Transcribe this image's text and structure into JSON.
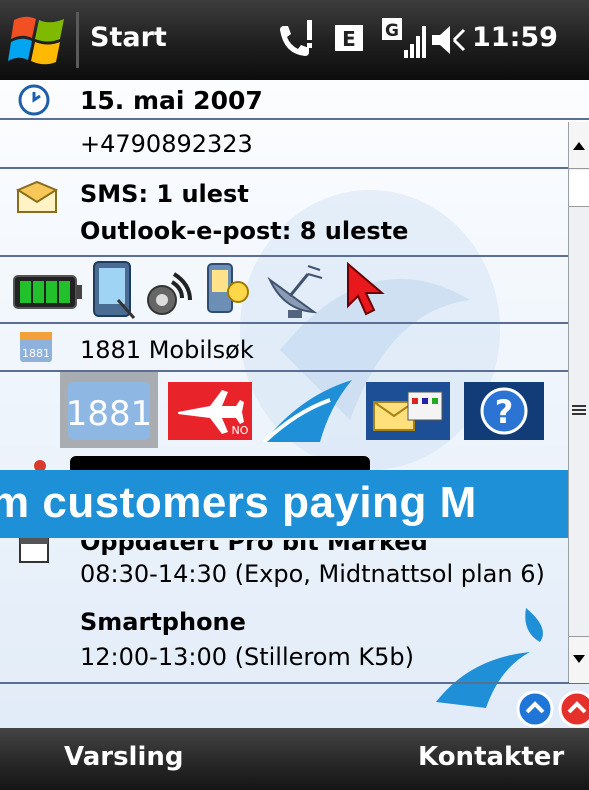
{
  "topbar": {
    "start_label": "Start",
    "time": "11:59",
    "network_badge": "E",
    "signal_badge": "G"
  },
  "today": {
    "date": "15. mai 2007",
    "caller_number": "+4790892323",
    "sms": "SMS: 1 ulest",
    "email": "Outlook-e-post: 8 uleste",
    "search_label": "1881 Mobilsøk",
    "tile_1881": "1881",
    "tile_no": "NO",
    "tile_help": "?",
    "calendar": [
      {
        "title": "Oppdatert Pro bit Marked",
        "detail": "08:30-14:30 (Expo, Midtnattsol plan 6)"
      },
      {
        "title": "Smartphone",
        "detail": "12:00-13:00 (Stillerom K5b)"
      }
    ]
  },
  "overlay": {
    "banner_text": "m customers paying M"
  },
  "softkeys": {
    "left": "Varsling",
    "right": "Kontakter"
  },
  "colors": {
    "banner": "#1e90d8",
    "telenor_blue": "#1f8fd8",
    "bar_dark": "#262626"
  }
}
